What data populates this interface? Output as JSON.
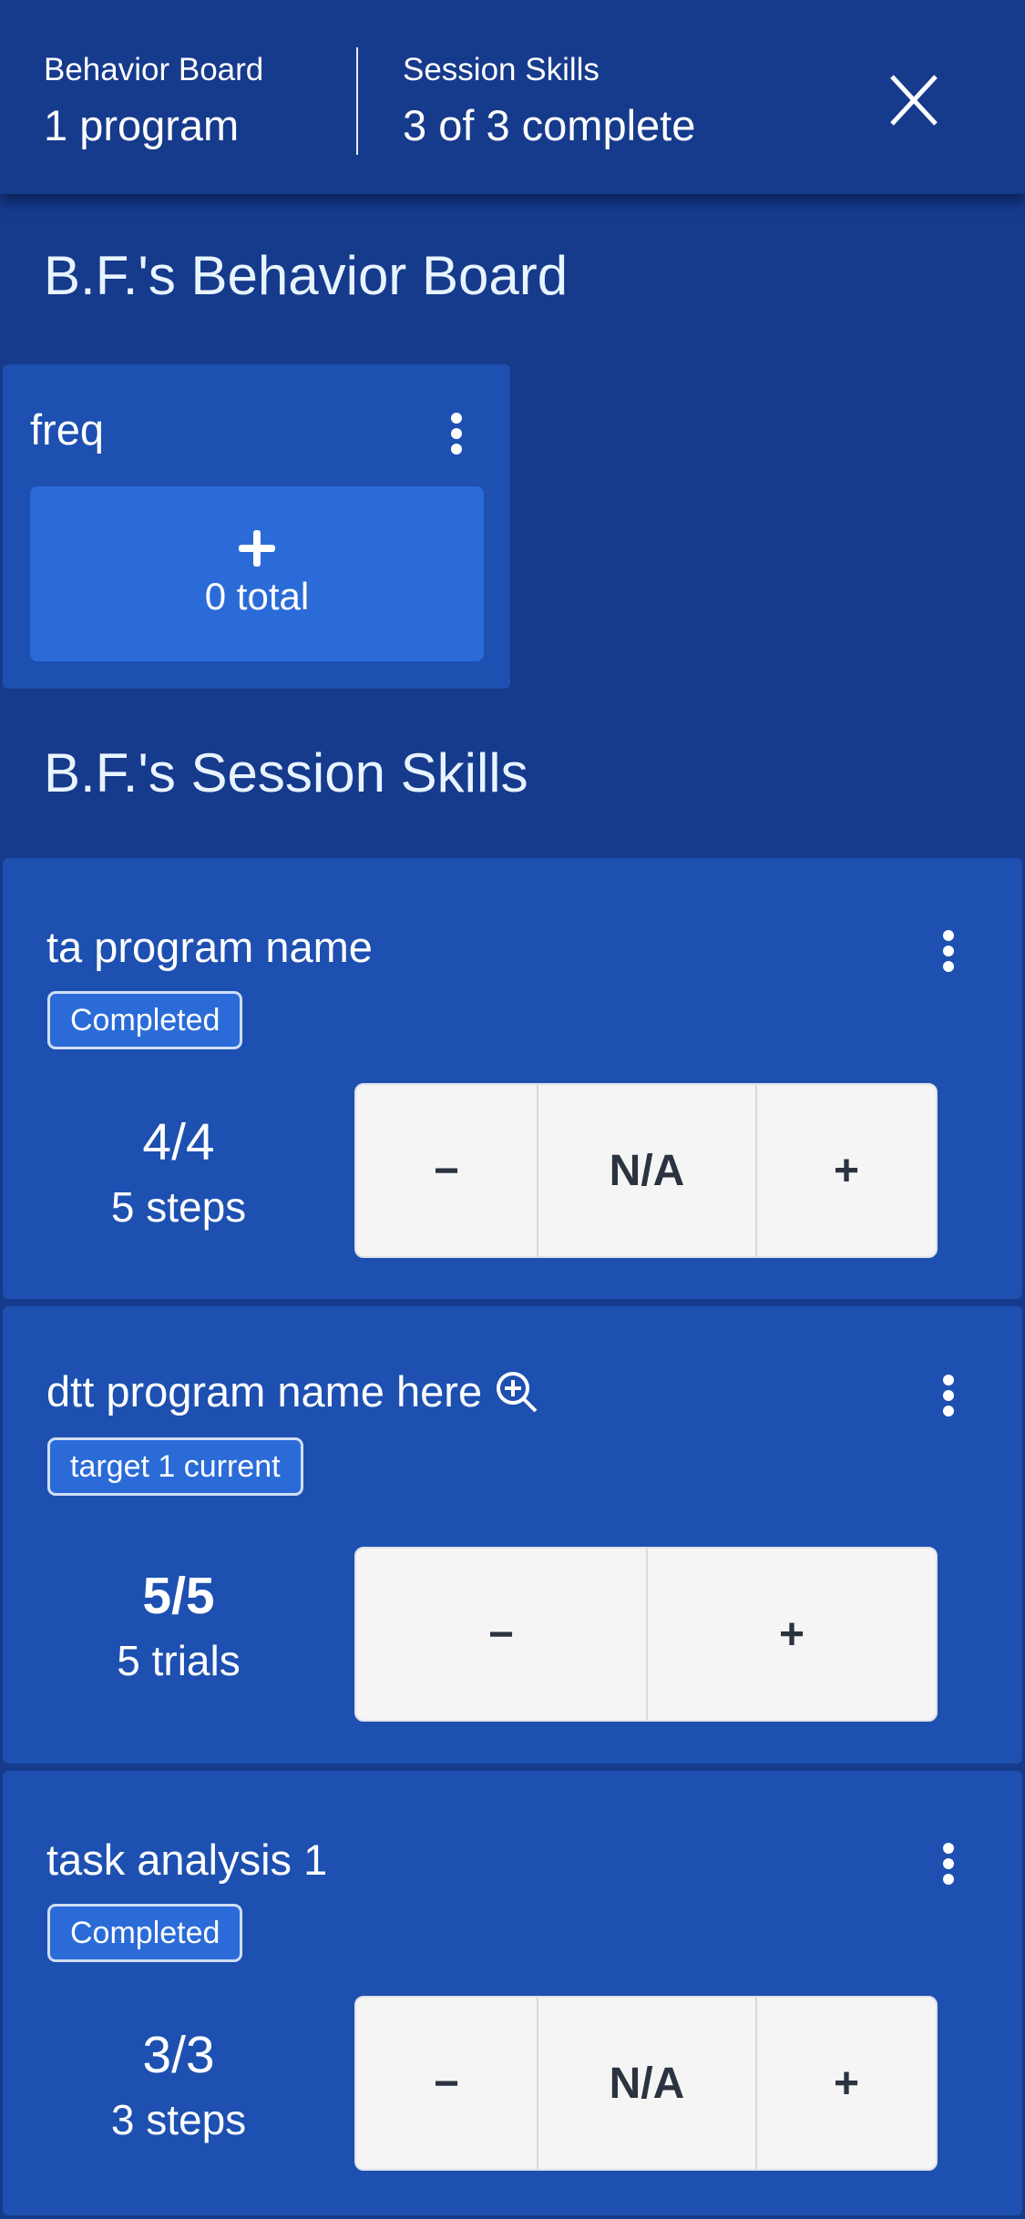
{
  "header": {
    "behavior_board": {
      "label": "Behavior Board",
      "value": "1 program"
    },
    "session_skills": {
      "label": "Session Skills",
      "value": "3 of 3 complete"
    },
    "close_icon": "close-x-icon"
  },
  "behavior_section": {
    "title": "B.F.'s Behavior Board",
    "cards": [
      {
        "name": "freq",
        "menu_icon": "kebab-icon",
        "add_icon": "plus-icon",
        "total_label": "0 total"
      }
    ]
  },
  "skills_section": {
    "title": "B.F.'s Session Skills",
    "cards": [
      {
        "name": "ta program name",
        "badge": "Completed",
        "stat_value": "4/4",
        "stat_label": "5 steps",
        "controls": [
          "−",
          "N/A",
          "+"
        ]
      },
      {
        "name": "dtt program name here",
        "name_icon": "zoom-in-icon",
        "badge": "target 1 current",
        "stat_value": "5/5",
        "stat_label": "5 trials",
        "controls": [
          "−",
          "+"
        ]
      },
      {
        "name": "task analysis 1",
        "badge": "Completed",
        "stat_value": "3/3",
        "stat_label": "3 steps",
        "controls": [
          "−",
          "N/A",
          "+"
        ]
      }
    ]
  },
  "colors": {
    "background": "#163a8c",
    "card": "#1d50b0",
    "accent_button": "#2a6bd8",
    "control_bg": "#f5f5f5",
    "control_text": "#2b3340"
  }
}
